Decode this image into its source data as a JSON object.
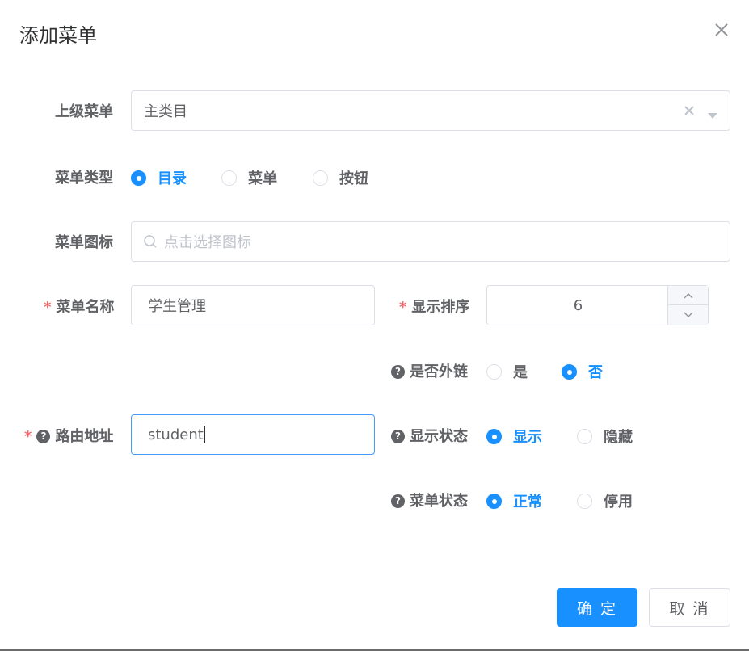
{
  "dialog": {
    "title": "添加菜单"
  },
  "form": {
    "parent_menu": {
      "label": "上级菜单",
      "value": "主类目"
    },
    "menu_type": {
      "label": "菜单类型",
      "options": [
        "目录",
        "菜单",
        "按钮"
      ],
      "selected": "目录"
    },
    "menu_icon": {
      "label": "菜单图标",
      "placeholder": "点击选择图标"
    },
    "menu_name": {
      "label": "菜单名称",
      "required_mark": "*",
      "value": "学生管理"
    },
    "display_order": {
      "label": "显示排序",
      "required_mark": "*",
      "value": "6"
    },
    "external_link": {
      "label": "是否外链",
      "help": "?",
      "options": [
        "是",
        "否"
      ],
      "selected": "否"
    },
    "route_path": {
      "label": "路由地址",
      "required_mark": "*",
      "help": "?",
      "value": "student"
    },
    "display_status": {
      "label": "显示状态",
      "help": "?",
      "options": [
        "显示",
        "隐藏"
      ],
      "selected": "显示"
    },
    "menu_status": {
      "label": "菜单状态",
      "help": "?",
      "options": [
        "正常",
        "停用"
      ],
      "selected": "正常"
    }
  },
  "footer": {
    "confirm_label": "确 定",
    "cancel_label": "取 消"
  },
  "colors": {
    "primary": "#1890ff",
    "required": "#f56c6c",
    "border": "#dcdfe6",
    "text": "#606266"
  }
}
